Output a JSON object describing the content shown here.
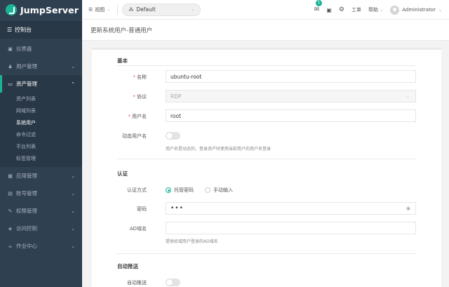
{
  "app": {
    "name": "JumpServer"
  },
  "sidebar": {
    "dashboard": "控制台",
    "items": [
      {
        "label": "仪表盘",
        "icon": "chart-icon"
      },
      {
        "label": "用户管理",
        "icon": "users-icon"
      },
      {
        "label": "资产管理",
        "icon": "inbox-icon"
      },
      {
        "label": "应用管理",
        "icon": "grid-icon"
      },
      {
        "label": "账号管理",
        "icon": "id-card-icon"
      },
      {
        "label": "权限管理",
        "icon": "edit-icon"
      },
      {
        "label": "访问控制",
        "icon": "shield-icon"
      },
      {
        "label": "作业中心",
        "icon": "coffee-icon"
      }
    ],
    "asset_sub": [
      "资产列表",
      "网域列表",
      "系统用户",
      "命令过滤",
      "平台列表",
      "标签管理"
    ]
  },
  "topbar": {
    "view_label": "视图",
    "org": "Default",
    "notification_count": "1",
    "workorder": "工单",
    "help": "帮助",
    "user": "Administrator"
  },
  "page": {
    "title": "更新系统用户-普通用户"
  },
  "form": {
    "basic_title": "基本",
    "name_label": "名称",
    "name_value": "ubuntu-root",
    "protocol_label": "协议",
    "protocol_value": "RDP",
    "username_label": "用户名",
    "username_value": "root",
    "dynamic_label": "动态用户名",
    "dynamic_help": "用户名是动态的，登录资产时使用当前用户的用户名登录",
    "auth_title": "认证",
    "auth_method_label": "认证方式",
    "auth_option1": "托管密码",
    "auth_option2": "手动输入",
    "password_label": "密码",
    "password_value": "•••",
    "ad_label": "AD域名",
    "ad_value": "",
    "ad_help": "提供给域用户登录的AD域名",
    "push_title": "自动推送",
    "push_label": "自动推送"
  },
  "colors": {
    "accent": "#1ab394",
    "sidebar": "#2f4050",
    "required": "#ed5565"
  }
}
